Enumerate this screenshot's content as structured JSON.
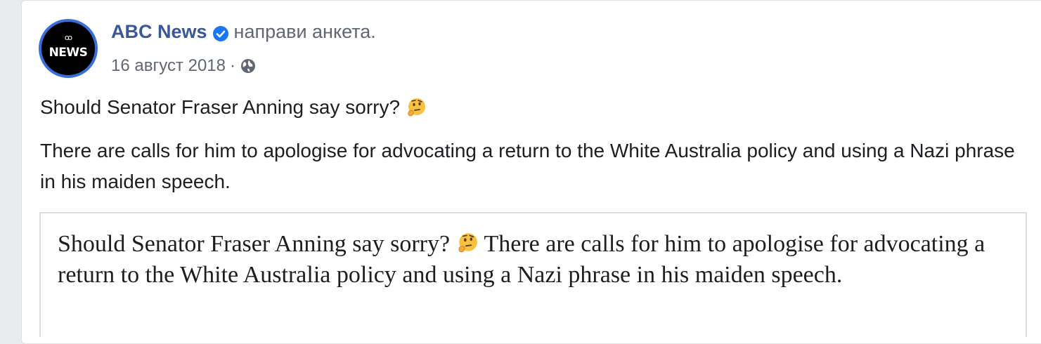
{
  "post": {
    "author": "ABC News",
    "action": "направи анкета.",
    "date": "16 август 2018",
    "separator": "·",
    "privacy_icon": "globe-icon",
    "verified_icon": "verified-badge-icon",
    "avatar": {
      "logo_text": "ꝏ",
      "label": "NEWS"
    },
    "title": "Should Senator Fraser Anning say sorry?",
    "title_emoji": "thinking-face-emoji",
    "body": "There are calls for him to apologise for advocating a return to the White Australia policy and using a Nazi phrase in his maiden speech."
  },
  "embed": {
    "text_part1": "Should Senator Fraser Anning say sorry?",
    "text_part2": "There are calls for him to apologise for advocating a return to the White Australia policy and using a Nazi phrase in his maiden speech.",
    "emoji": "thinking-face-emoji"
  },
  "colors": {
    "author_link": "#385898",
    "secondary_text": "#606770",
    "primary_text": "#1c1e21",
    "avatar_ring": "#3b6fd8",
    "verified": "#1877f2"
  }
}
